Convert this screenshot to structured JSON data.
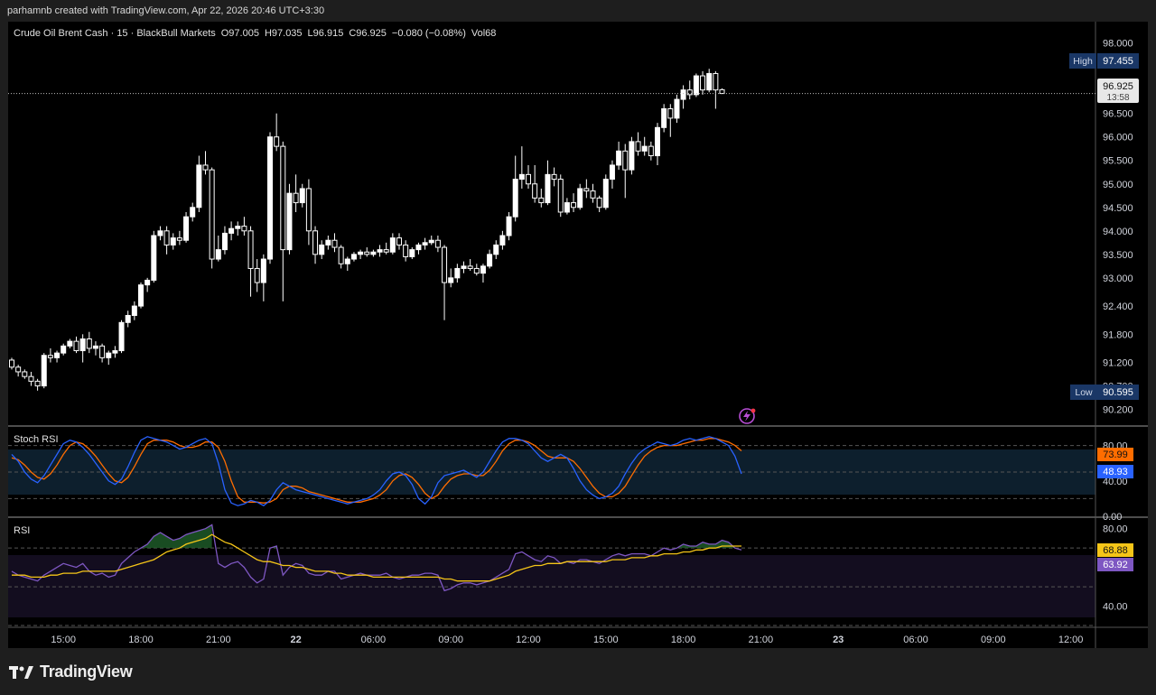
{
  "header": {
    "credit": "parhamnb created with TradingView.com, Apr 22, 2026 20:46 UTC+3:30"
  },
  "legend": {
    "symbol": "Crude Oil Brent Cash · 15 · BlackBull Markets",
    "o": "O97.005",
    "h": "H97.035",
    "l": "L96.915",
    "c": "C96.925",
    "change": "−0.080 (−0.08%)",
    "vol": "Vol68"
  },
  "markers": {
    "high_label": "High",
    "high_value": "97.455",
    "low_label": "Low",
    "low_value": "90.595",
    "last_price": "96.925",
    "countdown": "13:58"
  },
  "colors": {
    "up": "#ffffff",
    "down": "#ffffff",
    "stoch_k": "#2962ff",
    "stoch_d": "#ff6d00",
    "rsi": "#7e57c2",
    "rsi_ma": "#f5c518",
    "high_low_badge": "#1e3a6e"
  },
  "price_axis": [
    "98.000",
    "97.000",
    "96.500",
    "96.000",
    "95.500",
    "95.000",
    "94.500",
    "94.000",
    "93.500",
    "93.000",
    "92.400",
    "91.800",
    "91.200",
    "90.700",
    "90.200"
  ],
  "time_axis": [
    "15:00",
    "18:00",
    "21:00",
    "22",
    "06:00",
    "09:00",
    "12:00",
    "15:00",
    "18:00",
    "21:00",
    "23",
    "06:00",
    "09:00",
    "12:00"
  ],
  "stoch": {
    "title": "Stoch RSI",
    "value_k": "48.93",
    "value_d": "73.99",
    "ticks": [
      "80.00",
      "40.00",
      "0.00"
    ]
  },
  "rsi": {
    "title": "RSI",
    "value_rsi": "63.92",
    "value_ma": "68.88",
    "ticks": [
      "80.00",
      "60.00",
      "40.00"
    ]
  },
  "footer": {
    "brand": "TradingView"
  },
  "chart_data": [
    {
      "type": "candlestick",
      "title": "Crude Oil Brent Cash · 15 · BlackBull Markets",
      "ylim": [
        90.0,
        98.3
      ],
      "interval_minutes": 15,
      "start": "Apr 21 13:00",
      "candles": [
        [
          91.25,
          91.3,
          91.05,
          91.1
        ],
        [
          91.1,
          91.15,
          90.9,
          91.0
        ],
        [
          91.0,
          91.05,
          90.85,
          90.9
        ],
        [
          90.9,
          91.0,
          90.7,
          90.8
        ],
        [
          90.8,
          90.85,
          90.6,
          90.7
        ],
        [
          90.7,
          91.4,
          90.65,
          91.35
        ],
        [
          91.35,
          91.5,
          91.2,
          91.3
        ],
        [
          91.3,
          91.45,
          91.2,
          91.4
        ],
        [
          91.4,
          91.6,
          91.35,
          91.55
        ],
        [
          91.55,
          91.7,
          91.5,
          91.65
        ],
        [
          91.65,
          91.75,
          91.4,
          91.45
        ],
        [
          91.45,
          91.8,
          91.2,
          91.7
        ],
        [
          91.7,
          91.85,
          91.4,
          91.5
        ],
        [
          91.5,
          91.65,
          91.35,
          91.55
        ],
        [
          91.55,
          91.6,
          91.2,
          91.3
        ],
        [
          91.3,
          91.45,
          91.15,
          91.4
        ],
        [
          91.4,
          91.55,
          91.3,
          91.45
        ],
        [
          91.45,
          92.1,
          91.4,
          92.05
        ],
        [
          92.05,
          92.3,
          91.95,
          92.2
        ],
        [
          92.2,
          92.5,
          92.1,
          92.4
        ],
        [
          92.4,
          92.9,
          92.35,
          92.85
        ],
        [
          92.85,
          93.0,
          92.7,
          92.95
        ],
        [
          92.95,
          94.0,
          92.9,
          93.9
        ],
        [
          93.9,
          94.1,
          93.8,
          94.0
        ],
        [
          94.0,
          94.1,
          93.5,
          93.7
        ],
        [
          93.7,
          93.95,
          93.6,
          93.85
        ],
        [
          93.85,
          94.0,
          93.7,
          93.8
        ],
        [
          93.8,
          94.4,
          93.75,
          94.3
        ],
        [
          94.3,
          94.6,
          94.2,
          94.5
        ],
        [
          94.5,
          95.6,
          94.4,
          95.4
        ],
        [
          95.4,
          95.7,
          95.2,
          95.3
        ],
        [
          95.3,
          95.35,
          93.2,
          93.4
        ],
        [
          93.4,
          93.9,
          93.35,
          93.6
        ],
        [
          93.6,
          94.1,
          93.5,
          93.95
        ],
        [
          93.95,
          94.2,
          93.8,
          94.05
        ],
        [
          94.05,
          94.2,
          93.9,
          94.1
        ],
        [
          94.1,
          94.3,
          93.9,
          94.0
        ],
        [
          94.0,
          94.1,
          92.6,
          93.2
        ],
        [
          93.2,
          93.4,
          92.7,
          92.9
        ],
        [
          92.9,
          93.5,
          92.5,
          93.4
        ],
        [
          93.4,
          96.1,
          93.3,
          96.0
        ],
        [
          96.0,
          96.5,
          95.7,
          95.8
        ],
        [
          95.8,
          95.9,
          92.5,
          93.6
        ],
        [
          93.6,
          95.0,
          93.5,
          94.8
        ],
        [
          94.8,
          95.2,
          94.4,
          94.6
        ],
        [
          94.6,
          95.0,
          94.5,
          94.9
        ],
        [
          94.9,
          95.1,
          93.7,
          94.0
        ],
        [
          94.0,
          94.1,
          93.3,
          93.5
        ],
        [
          93.5,
          93.8,
          93.4,
          93.7
        ],
        [
          93.7,
          93.9,
          93.6,
          93.8
        ],
        [
          93.8,
          93.95,
          93.55,
          93.65
        ],
        [
          93.65,
          93.7,
          93.2,
          93.3
        ],
        [
          93.3,
          93.45,
          93.15,
          93.4
        ],
        [
          93.4,
          93.55,
          93.35,
          93.5
        ],
        [
          93.5,
          93.6,
          93.4,
          93.55
        ],
        [
          93.55,
          93.65,
          93.45,
          93.5
        ],
        [
          93.5,
          93.6,
          93.45,
          93.55
        ],
        [
          93.55,
          93.7,
          93.45,
          93.6
        ],
        [
          93.6,
          93.75,
          93.5,
          93.55
        ],
        [
          93.55,
          93.95,
          93.5,
          93.85
        ],
        [
          93.85,
          93.95,
          93.6,
          93.7
        ],
        [
          93.7,
          93.8,
          93.35,
          93.45
        ],
        [
          93.45,
          93.65,
          93.4,
          93.6
        ],
        [
          93.6,
          93.75,
          93.5,
          93.7
        ],
        [
          93.7,
          93.85,
          93.6,
          93.75
        ],
        [
          93.75,
          93.9,
          93.7,
          93.8
        ],
        [
          93.8,
          93.9,
          93.55,
          93.65
        ],
        [
          93.65,
          93.7,
          92.1,
          92.9
        ],
        [
          92.9,
          93.2,
          92.8,
          93.0
        ],
        [
          93.0,
          93.3,
          92.9,
          93.2
        ],
        [
          93.2,
          93.35,
          93.1,
          93.25
        ],
        [
          93.25,
          93.4,
          93.15,
          93.2
        ],
        [
          93.2,
          93.3,
          93.05,
          93.1
        ],
        [
          93.1,
          93.3,
          92.9,
          93.25
        ],
        [
          93.25,
          93.6,
          93.2,
          93.5
        ],
        [
          93.5,
          93.8,
          93.4,
          93.7
        ],
        [
          93.7,
          94.0,
          93.6,
          93.9
        ],
        [
          93.9,
          94.4,
          93.8,
          94.3
        ],
        [
          94.3,
          95.6,
          94.2,
          95.1
        ],
        [
          95.1,
          95.8,
          94.9,
          95.2
        ],
        [
          95.2,
          95.4,
          94.9,
          95.0
        ],
        [
          95.0,
          95.4,
          94.6,
          94.7
        ],
        [
          94.7,
          94.9,
          94.5,
          94.6
        ],
        [
          94.6,
          95.5,
          94.55,
          95.2
        ],
        [
          95.2,
          95.35,
          94.95,
          95.1
        ],
        [
          95.1,
          95.2,
          94.3,
          94.4
        ],
        [
          94.4,
          94.7,
          94.35,
          94.6
        ],
        [
          94.6,
          94.8,
          94.4,
          94.5
        ],
        [
          94.5,
          95.0,
          94.45,
          94.9
        ],
        [
          94.9,
          95.1,
          94.7,
          94.85
        ],
        [
          94.85,
          95.0,
          94.6,
          94.7
        ],
        [
          94.7,
          94.75,
          94.4,
          94.5
        ],
        [
          94.5,
          95.2,
          94.45,
          95.1
        ],
        [
          95.1,
          95.5,
          94.9,
          95.4
        ],
        [
          95.4,
          95.9,
          95.3,
          95.7
        ],
        [
          95.7,
          95.85,
          94.7,
          95.3
        ],
        [
          95.3,
          96.0,
          95.2,
          95.9
        ],
        [
          95.9,
          96.1,
          95.6,
          95.7
        ],
        [
          95.7,
          96.0,
          95.6,
          95.8
        ],
        [
          95.8,
          95.9,
          95.5,
          95.6
        ],
        [
          95.6,
          96.3,
          95.4,
          96.2
        ],
        [
          96.2,
          96.7,
          96.1,
          96.6
        ],
        [
          96.6,
          96.7,
          96.0,
          96.4
        ],
        [
          96.4,
          96.9,
          96.3,
          96.8
        ],
        [
          96.8,
          97.1,
          96.6,
          97.0
        ],
        [
          97.0,
          97.2,
          96.8,
          96.9
        ],
        [
          96.9,
          97.35,
          96.85,
          97.3
        ],
        [
          97.3,
          97.4,
          96.9,
          97.0
        ],
        [
          97.0,
          97.45,
          96.95,
          97.35
        ],
        [
          97.35,
          97.4,
          96.6,
          97.0
        ],
        [
          97.005,
          97.035,
          96.915,
          96.925
        ]
      ]
    },
    {
      "type": "line",
      "title": "Stoch RSI",
      "ylim": [
        0,
        100
      ],
      "series": [
        {
          "name": "K",
          "values": [
            70,
            62,
            50,
            42,
            38,
            46,
            58,
            70,
            82,
            86,
            84,
            78,
            70,
            60,
            50,
            40,
            36,
            42,
            56,
            72,
            86,
            90,
            88,
            86,
            84,
            80,
            76,
            78,
            82,
            86,
            88,
            82,
            60,
            30,
            15,
            12,
            14,
            18,
            16,
            12,
            18,
            30,
            38,
            34,
            30,
            28,
            26,
            24,
            22,
            20,
            18,
            16,
            14,
            16,
            18,
            20,
            24,
            30,
            40,
            48,
            50,
            46,
            36,
            20,
            14,
            22,
            38,
            46,
            48,
            50,
            52,
            48,
            44,
            50,
            62,
            74,
            84,
            88,
            88,
            86,
            82,
            74,
            66,
            62,
            66,
            70,
            66,
            54,
            40,
            30,
            24,
            20,
            22,
            26,
            34,
            48,
            60,
            70,
            76,
            80,
            84,
            82,
            80,
            82,
            86,
            88,
            86,
            88,
            90,
            88,
            84,
            80,
            68,
            48
          ]
        },
        {
          "name": "D",
          "values": [
            66,
            64,
            58,
            50,
            44,
            42,
            48,
            58,
            70,
            80,
            84,
            82,
            76,
            68,
            58,
            48,
            40,
            38,
            44,
            56,
            70,
            82,
            86,
            86,
            86,
            84,
            80,
            78,
            78,
            80,
            84,
            84,
            78,
            62,
            40,
            22,
            16,
            16,
            16,
            15,
            16,
            20,
            30,
            34,
            34,
            32,
            28,
            26,
            24,
            22,
            20,
            18,
            16,
            16,
            16,
            18,
            20,
            24,
            30,
            40,
            46,
            48,
            44,
            36,
            26,
            20,
            24,
            34,
            42,
            46,
            48,
            48,
            46,
            46,
            52,
            62,
            74,
            82,
            86,
            86,
            84,
            80,
            74,
            68,
            66,
            66,
            66,
            62,
            54,
            44,
            34,
            26,
            22,
            22,
            26,
            34,
            46,
            58,
            68,
            74,
            78,
            80,
            80,
            80,
            82,
            84,
            86,
            86,
            88,
            88,
            86,
            84,
            80,
            74
          ]
        }
      ],
      "levels": [
        80,
        50,
        20
      ]
    },
    {
      "type": "line",
      "title": "RSI",
      "ylim": [
        30,
        85
      ],
      "series": [
        {
          "name": "RSI",
          "values": [
            58,
            56,
            55,
            54,
            53,
            56,
            58,
            60,
            62,
            61,
            60,
            62,
            58,
            56,
            57,
            55,
            56,
            62,
            65,
            68,
            70,
            72,
            76,
            78,
            76,
            74,
            75,
            77,
            78,
            79,
            80,
            82,
            62,
            60,
            62,
            63,
            60,
            55,
            52,
            54,
            70,
            71,
            56,
            60,
            62,
            61,
            57,
            56,
            56,
            58,
            58,
            54,
            55,
            56,
            57,
            56,
            56,
            56,
            57,
            55,
            54,
            55,
            56,
            56,
            57,
            57,
            56,
            48,
            49,
            51,
            52,
            52,
            51,
            52,
            53,
            55,
            57,
            59,
            67,
            68,
            66,
            64,
            63,
            66,
            65,
            62,
            63,
            62,
            64,
            64,
            63,
            62,
            64,
            66,
            67,
            66,
            67,
            67,
            67,
            66,
            68,
            70,
            69,
            70,
            72,
            71,
            71,
            73,
            72,
            72,
            74,
            73,
            70,
            69
          ]
        },
        {
          "name": "RSI MA",
          "values": [
            56,
            56,
            56,
            55,
            55,
            55,
            56,
            56,
            57,
            57,
            57,
            58,
            58,
            58,
            58,
            58,
            58,
            59,
            60,
            61,
            62,
            63,
            64,
            66,
            68,
            69,
            70,
            72,
            73,
            74,
            75,
            77,
            75,
            73,
            72,
            70,
            68,
            66,
            64,
            63,
            63,
            62,
            61,
            61,
            60,
            60,
            59,
            58,
            58,
            58,
            57,
            57,
            56,
            56,
            56,
            56,
            55,
            55,
            55,
            55,
            55,
            55,
            55,
            55,
            55,
            55,
            55,
            54,
            54,
            53,
            53,
            53,
            53,
            53,
            53,
            54,
            55,
            56,
            58,
            59,
            60,
            61,
            61,
            62,
            62,
            62,
            63,
            63,
            63,
            63,
            63,
            63,
            63,
            64,
            64,
            64,
            65,
            65,
            65,
            66,
            66,
            67,
            67,
            67,
            68,
            68,
            69,
            69,
            70,
            70,
            71,
            71,
            71,
            71
          ]
        }
      ],
      "levels": [
        70,
        50,
        30
      ]
    }
  ]
}
